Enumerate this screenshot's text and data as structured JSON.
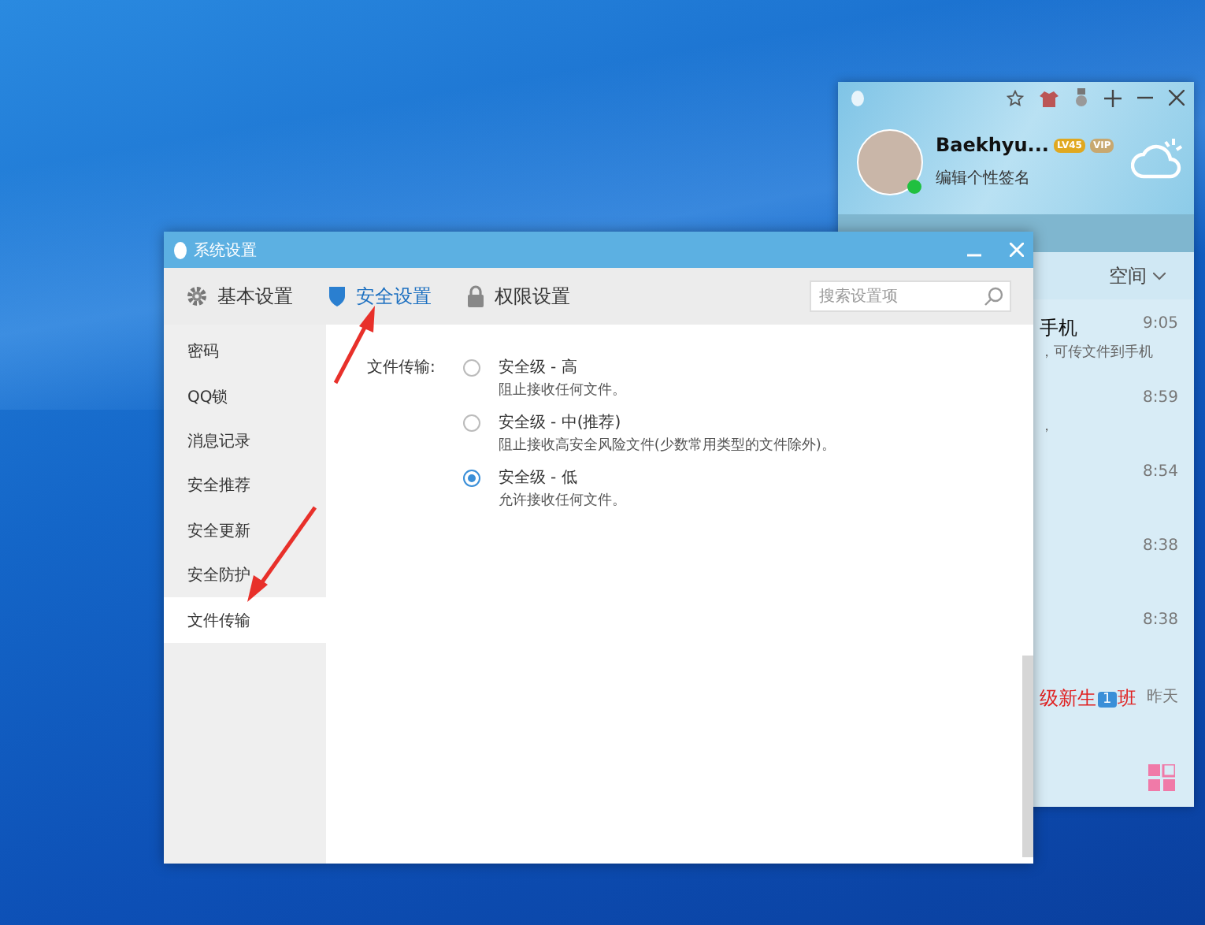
{
  "qq_panel": {
    "name": "Baekhyu...",
    "level_badge": "LV45",
    "vip_badge": "VIP",
    "signature": "编辑个性签名",
    "tab": "空间",
    "chats": [
      {
        "title": "手机",
        "preview": "，可传文件到手机",
        "time": "9:05",
        "highlighted": false
      },
      {
        "preview": "，",
        "time": "8:59"
      },
      {
        "time": "8:54"
      },
      {
        "time": "8:38"
      },
      {
        "time": "8:38"
      },
      {
        "title": "级新生",
        "badge": "1",
        "title_tail": "班",
        "time": "昨天",
        "highlighted": true
      }
    ]
  },
  "window": {
    "title": "系统设置"
  },
  "toolbar_tabs": [
    {
      "label": "基本设置",
      "selected": false
    },
    {
      "label": "安全设置",
      "selected": true
    },
    {
      "label": "权限设置",
      "selected": false
    }
  ],
  "search": {
    "placeholder": "搜索设置项"
  },
  "sidebar": [
    {
      "label": "密码",
      "selected": false
    },
    {
      "label": "QQ锁",
      "selected": false
    },
    {
      "label": "消息记录",
      "selected": false
    },
    {
      "label": "安全推荐",
      "selected": false
    },
    {
      "label": "安全更新",
      "selected": false
    },
    {
      "label": "安全防护",
      "selected": false
    },
    {
      "label": "文件传输",
      "selected": true
    }
  ],
  "setting": {
    "label": "文件传输:",
    "options": [
      {
        "title": "安全级 - 高",
        "description": "阻止接收任何文件。",
        "selected": false
      },
      {
        "title": "安全级 - 中(推荐)",
        "description": "阻止接收高安全风险文件(少数常用类型的文件除外)。",
        "selected": false
      },
      {
        "title": "安全级 - 低",
        "description": "允许接收任何文件。",
        "selected": true
      }
    ]
  }
}
